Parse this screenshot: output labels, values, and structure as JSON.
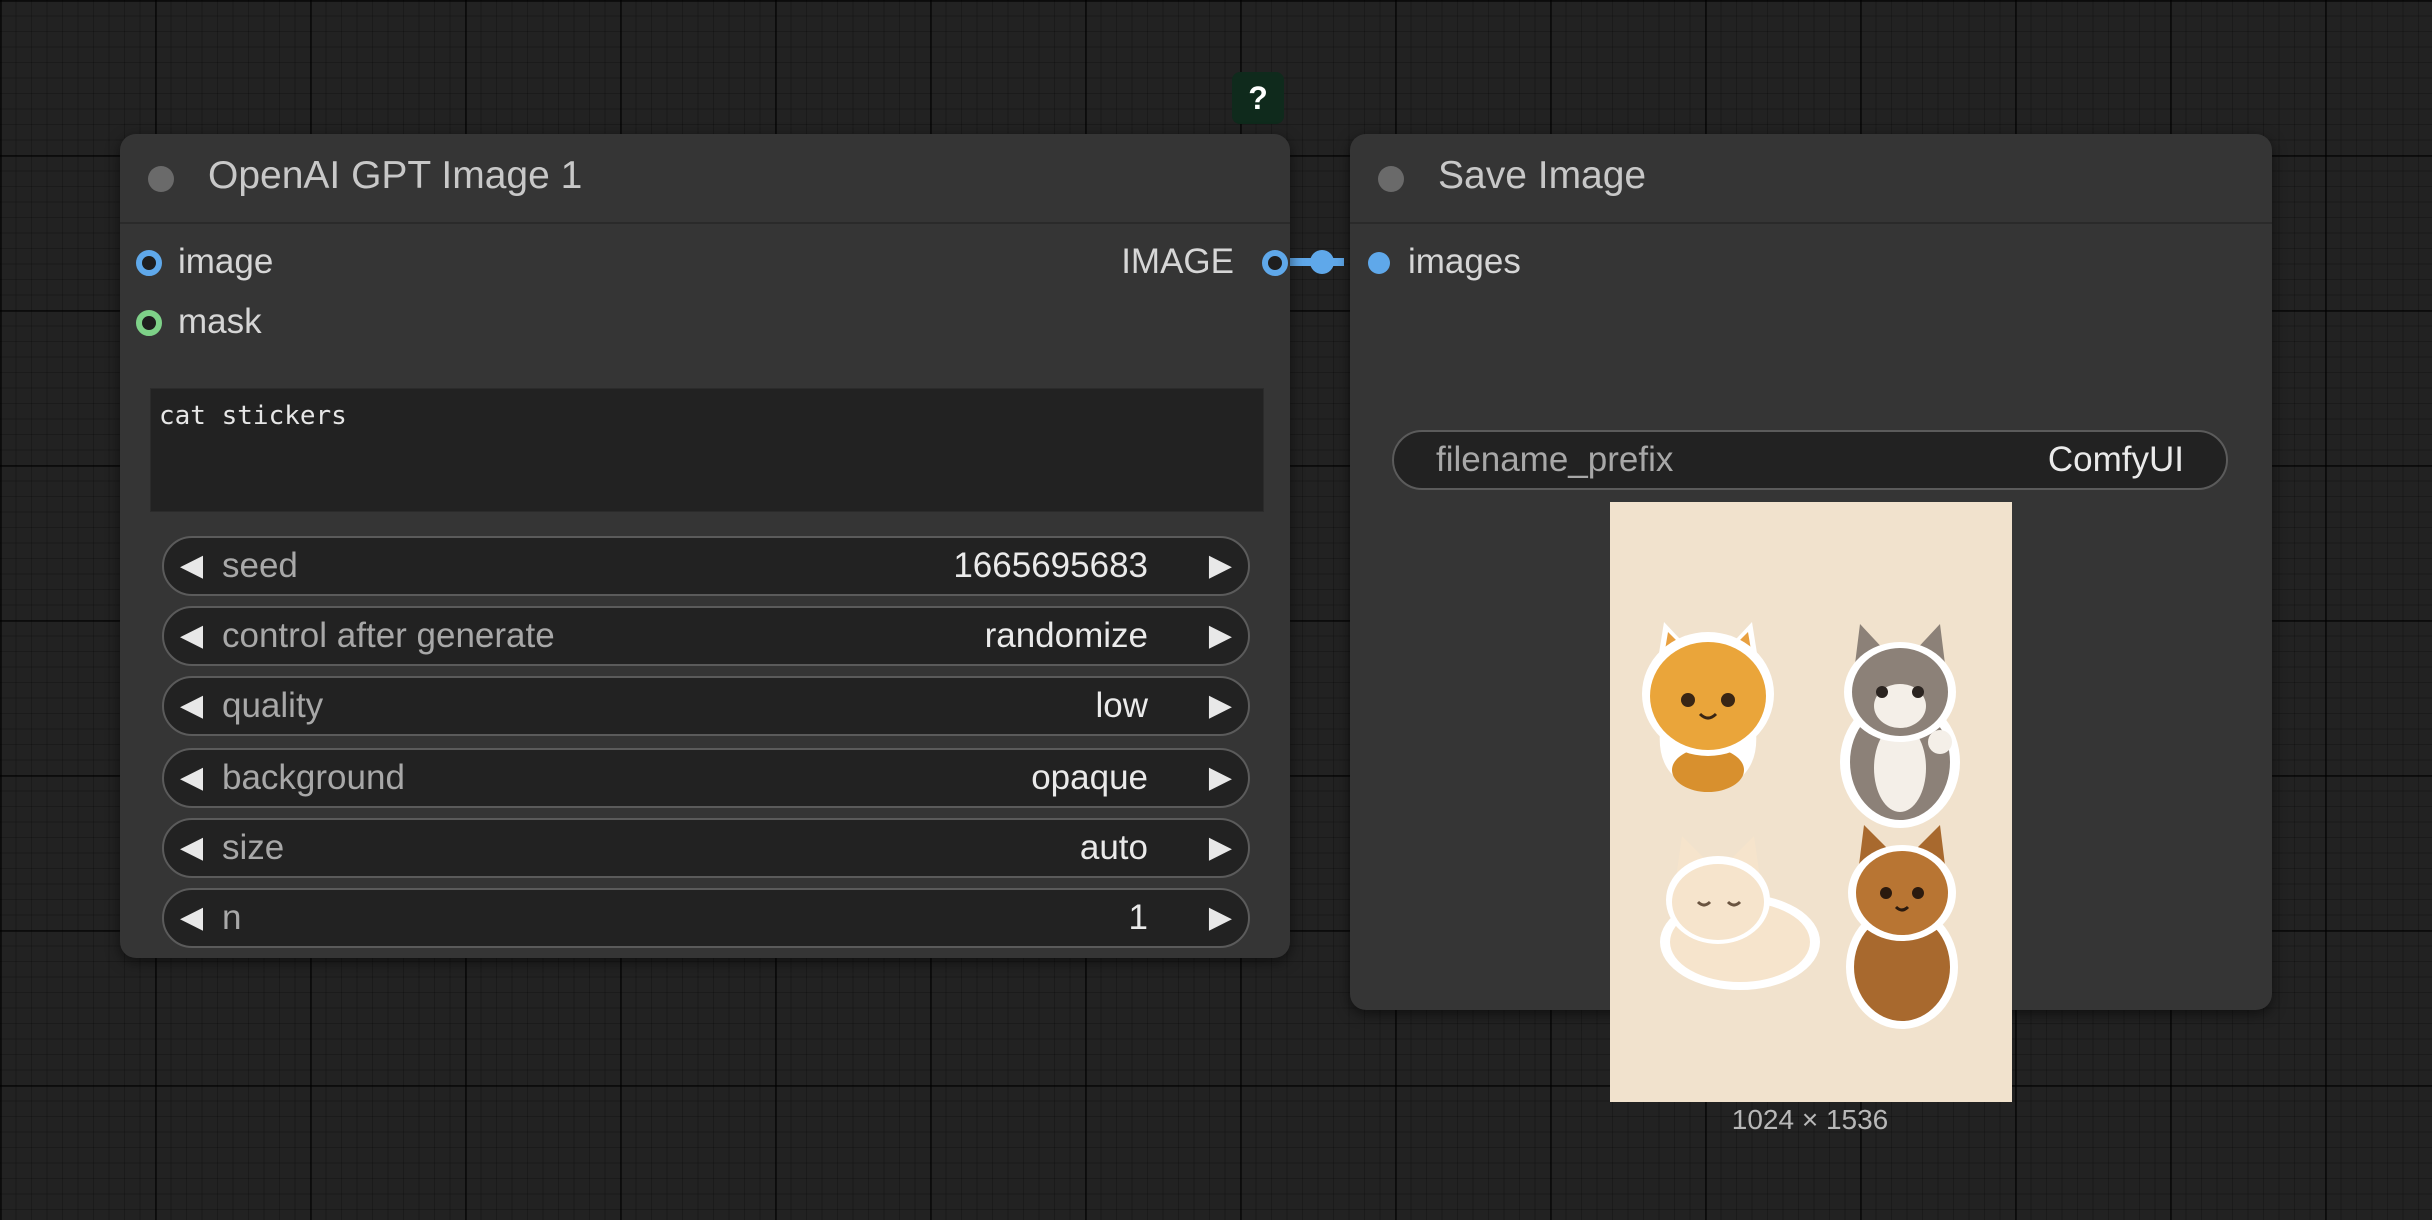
{
  "help_badge": "?",
  "node_gpt": {
    "title": "OpenAI GPT Image 1",
    "inputs": [
      "image",
      "mask"
    ],
    "output": "IMAGE",
    "prompt": "cat stickers",
    "widgets": [
      {
        "label": "seed",
        "value": "1665695683"
      },
      {
        "label": "control after generate",
        "value": "randomize"
      },
      {
        "label": "quality",
        "value": "low"
      },
      {
        "label": "background",
        "value": "opaque"
      },
      {
        "label": "size",
        "value": "auto"
      },
      {
        "label": "n",
        "value": "1"
      }
    ]
  },
  "node_save": {
    "title": "Save Image",
    "input": "images",
    "filename_prefix_label": "filename_prefix",
    "filename_prefix_value": "ComfyUI",
    "preview_size": "1024 × 1536"
  },
  "colors": {
    "canvas_bg": "#222222",
    "node_bg": "#353535",
    "image_slot": "#5fa8ea",
    "mask_slot": "#7ed188",
    "link": "#5fa8ea"
  },
  "icons": [
    "status-dot-icon",
    "arrow-left-icon",
    "arrow-right-icon",
    "help-icon"
  ]
}
